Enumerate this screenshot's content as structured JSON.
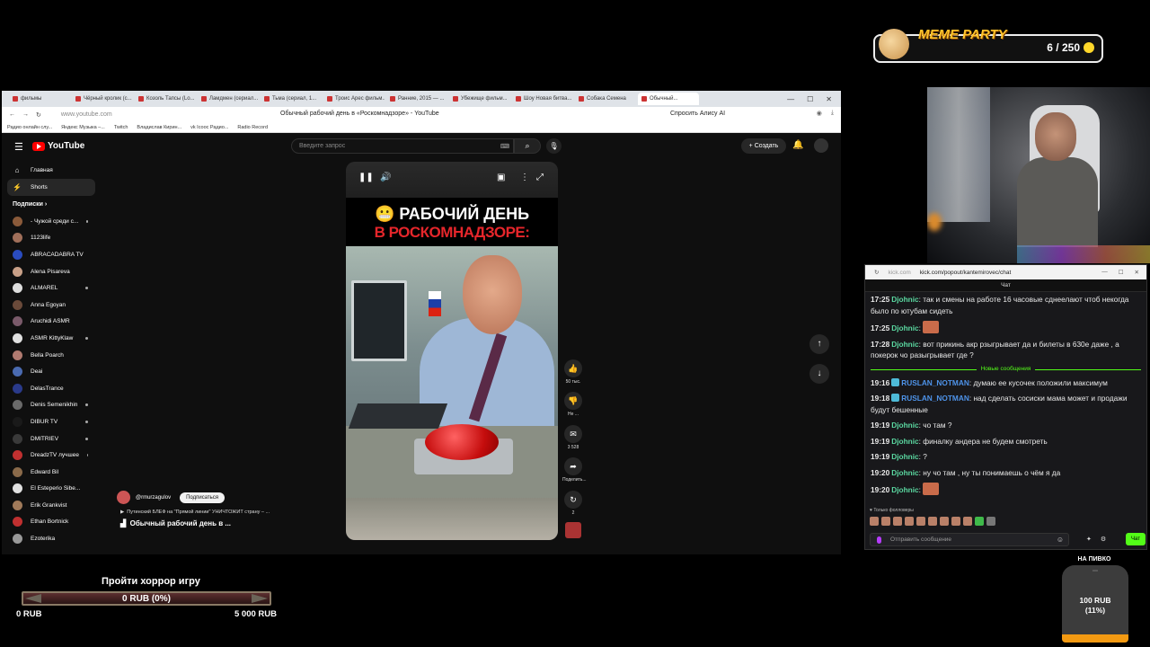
{
  "meme_party": {
    "title": "MEME PARTY",
    "count": "6 / 250"
  },
  "browser": {
    "tabs": [
      {
        "label": "фильмы"
      },
      {
        "label": "Чёрный кролик (с..."
      },
      {
        "label": "Козоль Тапсы (Lo..."
      },
      {
        "label": "Ламдмен (сериал..."
      },
      {
        "label": "Тьма (сериал, 1..."
      },
      {
        "label": "Троис Арес фильм..."
      },
      {
        "label": "Ранние, 2015 — ..."
      },
      {
        "label": "Убежище фильм..."
      },
      {
        "label": "Шоу Новая битва..."
      },
      {
        "label": "Собака Семена"
      },
      {
        "label": "Обычный..."
      }
    ],
    "url": "www.youtube.com",
    "page_title": "Обычный рабочий день в «Роскомнадзоре» - YouTube",
    "alice": "Спросить Алису AI",
    "bookmarks": [
      "Радио онлайн слу...",
      "Яндекс Музыка –...",
      "Twitch",
      "Владислав Кирин...",
      "vk Iсоос Радио...",
      "Radio Record"
    ]
  },
  "youtube": {
    "search_placeholder": "Введите запрос",
    "create_label": "Создать",
    "nav": [
      {
        "label": "Главная",
        "icon": "home-icon"
      },
      {
        "label": "Shorts",
        "icon": "shorts-icon"
      }
    ],
    "subscriptions_label": "Подписки",
    "subscriptions": [
      {
        "name": "- Чужой среди с...",
        "color": "#8a5a3a",
        "dot": true
      },
      {
        "name": "1123life",
        "color": "#a06f5a",
        "dot": false
      },
      {
        "name": "ABRACADABRA TV",
        "color": "#2a4cc0",
        "dot": false
      },
      {
        "name": "Alena Pisareva",
        "color": "#c8a088",
        "dot": false
      },
      {
        "name": "ALMAREL",
        "color": "#ddd",
        "dot": true
      },
      {
        "name": "Anna Egoyan",
        "color": "#6a4a3a",
        "dot": false
      },
      {
        "name": "Aruchidi ASMR",
        "color": "#7a5a6a",
        "dot": false
      },
      {
        "name": "ASMR KittyKlaw",
        "color": "#e0e0e0",
        "dot": true
      },
      {
        "name": "Bella Poarch",
        "color": "#b07a70",
        "dot": false
      },
      {
        "name": "Deai",
        "color": "#4a6ab0",
        "dot": false
      },
      {
        "name": "DelasTrance",
        "color": "#2a3a8a",
        "dot": false
      },
      {
        "name": "Denis Semenikhin",
        "color": "#6a6a6a",
        "dot": true
      },
      {
        "name": "DIBUR TV",
        "color": "#1a1a1a",
        "dot": true
      },
      {
        "name": "DMITRIEV",
        "color": "#3a3a3a",
        "dot": true
      },
      {
        "name": "DreadzTV лучшее",
        "color": "#c03030",
        "dot": true
      },
      {
        "name": "Edward Bil",
        "color": "#8a6a4a",
        "dot": false
      },
      {
        "name": "El Esteperio Sibe...",
        "color": "#e0e0e0",
        "dot": true
      },
      {
        "name": "Erik Grankvist",
        "color": "#a07a5a",
        "dot": false
      },
      {
        "name": "Ethan Bortnick",
        "color": "#c03030",
        "dot": false
      },
      {
        "name": "Ezoterika",
        "color": "#999",
        "dot": false
      }
    ],
    "short": {
      "caption_line1": "😬 РАБОЧИЙ ДЕНЬ",
      "caption_line2": "В РОСКОМНАДЗОРЕ:"
    },
    "actions": {
      "likes": "50 тыс.",
      "dislike": "Не ...",
      "comments": "3 528",
      "share": "Поделить...",
      "remix": "2"
    },
    "channel": {
      "handle": "@rmurzagulov",
      "subscribe": "Подписаться",
      "related": "Путинский БЛЕФ на \"Прямой линии\" УНИЧТОЖИТ страну – ...",
      "title": "Обычный рабочий день в ..."
    }
  },
  "chat": {
    "host": "kick.com",
    "path": "kick.com/popout/kantemirovec/chat",
    "header": "Чат",
    "messages_before": [
      {
        "time": "17:25",
        "user": "Djohnic",
        "color": "g",
        "text": "так и смены на работе 16 часовые сднеелают чтоб некогда было по ютубам сидеть"
      },
      {
        "time": "17:25",
        "user": "Djohnic",
        "color": "g",
        "text": "",
        "emote": true
      },
      {
        "time": "17:28",
        "user": "Djohnic",
        "color": "g",
        "text": "вот прикинь акр рзыгрывает да и билеты в 630е даже , а покерок чо разыгрывает где ?"
      }
    ],
    "new_messages_label": "Новые сообщения",
    "messages_after": [
      {
        "time": "19:16",
        "user": "RUSLAN_NOTMAN",
        "color": "b",
        "badge": true,
        "text": "думаю ее кусочек положили максимум"
      },
      {
        "time": "19:18",
        "user": "RUSLAN_NOTMAN",
        "color": "b",
        "badge": true,
        "text": "над сделать сосиски мама может и продажи будут бешенные"
      },
      {
        "time": "19:19",
        "user": "Djohnic",
        "color": "g",
        "text": "чо там ?"
      },
      {
        "time": "19:19",
        "user": "Djohnic",
        "color": "g",
        "text": "финалку андера не будем смотреть"
      },
      {
        "time": "19:19",
        "user": "Djohnic",
        "color": "g",
        "text": "?"
      },
      {
        "time": "19:20",
        "user": "Djohnic",
        "color": "g",
        "text": "ну чо там , ну ты понимаешь о чём я да"
      },
      {
        "time": "19:20",
        "user": "Djohnic",
        "color": "g",
        "text": "",
        "emote": true
      }
    ],
    "followers_only": "Только фолловеры",
    "input_placeholder": "Отправить сообщение",
    "send_label": "Чат"
  },
  "horror_goal": {
    "title": "Пройти хоррор игру",
    "value_label": "0 RUB (0%)",
    "min": "0 RUB",
    "max": "5 000 RUB",
    "progress": 0
  },
  "beer_goal": {
    "title": "НА ПИВКО",
    "value_line1": "100 RUB",
    "value_line2": "(11%)",
    "progress": 0.11
  }
}
